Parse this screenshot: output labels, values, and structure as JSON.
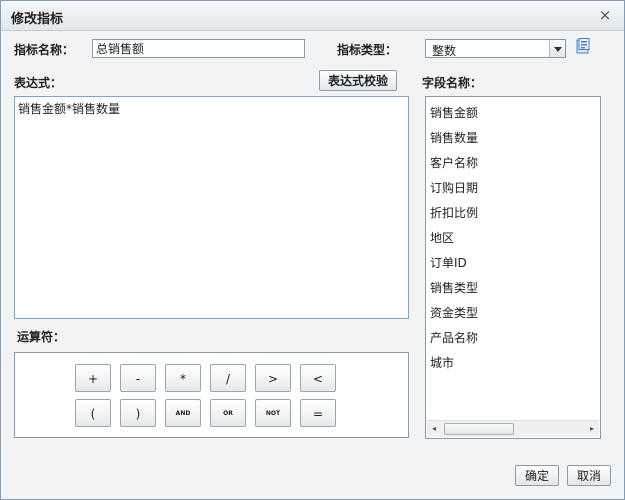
{
  "dialog": {
    "title": "修改指标",
    "close_glyph": "×"
  },
  "form": {
    "name_label": "指标名称：",
    "name_value": "总销售额",
    "type_label": "指标类型：",
    "type_value": "整数",
    "expr_label": "表达式：",
    "validate_label": "表达式校验",
    "expr_value": "销售金额*销售数量",
    "fields_label": "字段名称：",
    "ops_label": "运算符："
  },
  "fields": [
    "销售金额",
    "销售数量",
    "客户名称",
    "订购日期",
    "折扣比例",
    "地区",
    "订单ID",
    "销售类型",
    "资金类型",
    "产品名称",
    "城市"
  ],
  "operators": {
    "row1": [
      "+",
      "-",
      "*",
      "/",
      ">",
      "<"
    ],
    "row2": [
      "(",
      ")",
      "AND",
      "OR",
      "NOT",
      "="
    ]
  },
  "scroll": {
    "left_glyph": "◂",
    "right_glyph": "▸"
  },
  "footer": {
    "ok_label": "确定",
    "cancel_label": "取消"
  },
  "icons": {
    "help": "help-icon",
    "close": "close-icon",
    "dropdown": "chevron-down-icon"
  }
}
